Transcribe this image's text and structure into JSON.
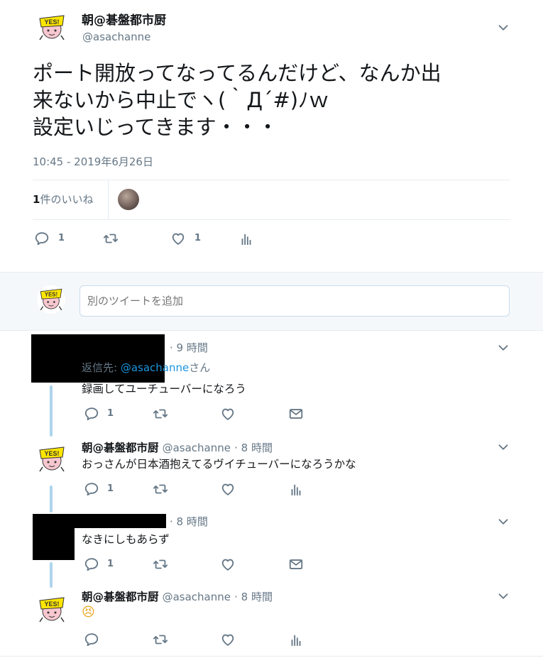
{
  "main_tweet": {
    "display_name": "朝@碁盤都市厨",
    "handle": "@asachanne",
    "text_lines": [
      "ポート開放ってなってるんだけど、なんか出",
      "来ないから中止でヽ(｀Д´#)ﾉｗ",
      "設定いじってきます・・・"
    ],
    "timestamp": "10:45 - 2019年6月26日",
    "likes_count": "1",
    "likes_label": "件のいいね",
    "reply_count": "1",
    "like_count": "1"
  },
  "composer": {
    "placeholder": "別のツイートを追加"
  },
  "replies": [
    {
      "time": "· 9 時間",
      "reply_to_prefix": "返信先: ",
      "reply_to_handle": "@asachanne",
      "reply_to_suffix": "さん",
      "text": "録画してユーチューバーになろう",
      "reply_count": "1"
    },
    {
      "display_name": "朝@碁盤都市厨",
      "handle": "@asachanne",
      "time": "· 8 時間",
      "text": "おっさんが日本酒抱えてるヴイチューバーになろうかな",
      "reply_count": "1"
    },
    {
      "time": "· 8 時間",
      "text": "なきにしもあらず",
      "reply_count": "1"
    },
    {
      "display_name": "朝@碁盤都市厨",
      "handle": "@asachanne",
      "time": "· 8 時間",
      "text": "😣"
    }
  ],
  "colors": {
    "accent": "#1da1f2",
    "thread_line": "#aed4ec",
    "muted": "#657786",
    "link": "#1b95e0"
  }
}
